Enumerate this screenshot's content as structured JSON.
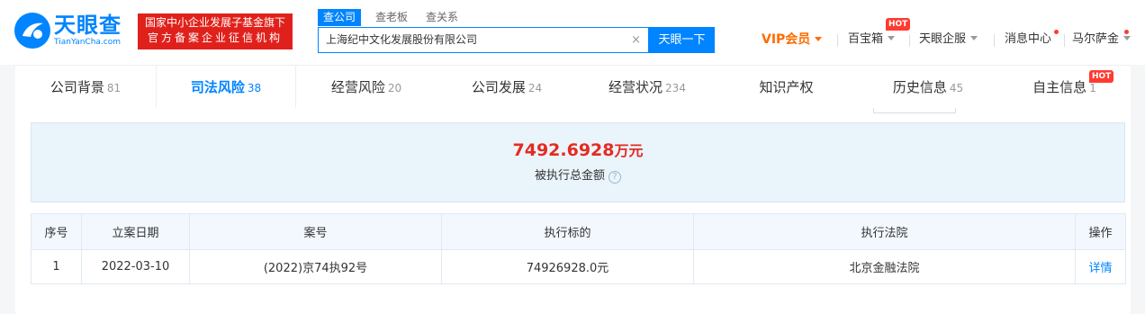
{
  "header": {
    "logo_text": "天眼查",
    "logo_sub": "TianYanCha.com",
    "banner_line1": "国家中小企业发展子基金旗下",
    "banner_line2": "官方备案企业征信机构",
    "search": {
      "tabs": [
        "查公司",
        "查老板",
        "查关系"
      ],
      "query": "上海纪中文化发展股份有限公司",
      "clear_glyph": "×",
      "button": "天眼一下"
    },
    "nav": {
      "vip": "VIP会员",
      "baibaoxiang": "百宝箱",
      "hot": "HOT",
      "qifu": "天眼企服",
      "messages": "消息中心",
      "user": "马尔萨金"
    }
  },
  "tabs": [
    {
      "label": "公司背景",
      "count": "81"
    },
    {
      "label": "司法风险",
      "count": "38"
    },
    {
      "label": "经营风险",
      "count": "20"
    },
    {
      "label": "公司发展",
      "count": "24"
    },
    {
      "label": "经营状况",
      "count": "234"
    },
    {
      "label": "知识产权",
      "count": ""
    },
    {
      "label": "历史信息",
      "count": "45"
    },
    {
      "label": "自主信息",
      "count": "1"
    }
  ],
  "tab_hot": "HOT",
  "summary": {
    "amount": "7492.6928",
    "unit": "万元",
    "label": "被执行总金额",
    "help_glyph": "?"
  },
  "table": {
    "headers": [
      "序号",
      "立案日期",
      "案号",
      "执行标的",
      "执行法院",
      "操作"
    ],
    "rows": [
      {
        "no": "1",
        "date": "2022-03-10",
        "case_no": "(2022)京74执92号",
        "amount": "74926928.0元",
        "court": "北京金融法院",
        "action": "详情"
      }
    ]
  },
  "colors": {
    "brand": "#0084ff",
    "amount_red": "#e42b23",
    "vip_orange": "#ff6b00",
    "banner_red": "#e0211b"
  }
}
